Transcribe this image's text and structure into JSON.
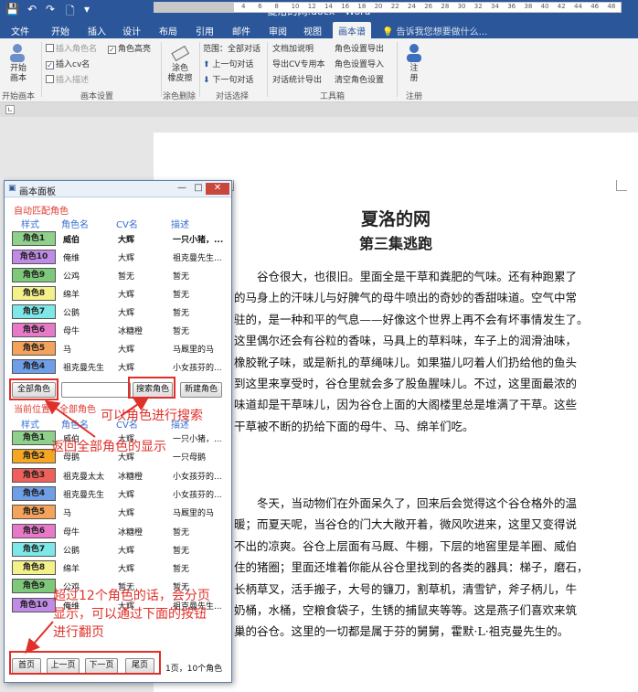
{
  "titlebar": {
    "title": "夏洛的网.docx - Word",
    "qa_save": "💾",
    "qa_undo": "↶",
    "qa_redo": "↷",
    "qa_new": "🗋",
    "qa_more": "▾"
  },
  "tabs": [
    "文件",
    "开始",
    "插入",
    "设计",
    "布局",
    "引用",
    "邮件",
    "审阅",
    "视图",
    "画本谱"
  ],
  "active_tab_index": 9,
  "tell_me": "告诉我您想要做什么...",
  "ribbon": {
    "g1": {
      "button": "开始\n画本",
      "label": "开始画本"
    },
    "g2": {
      "insert_role_name": "插入角色名",
      "insert_cv_name": "插入cv名",
      "insert_desc": "插入描述",
      "role_highlight": "角色高亮",
      "label": "画本设置"
    },
    "g3": {
      "button": "涂色\n橡皮擦",
      "label": "涂色删除"
    },
    "g4": {
      "range": "范围：全部对话",
      "prev": "上一句对话",
      "next": "下一句对话",
      "label": "对话选择"
    },
    "g5": {
      "c1": [
        "文档加说明",
        "导出CV专用本",
        "对话统计导出"
      ],
      "c2": [
        "角色设置导出",
        "角色设置导入",
        "清空角色设置"
      ],
      "label": "工具箱"
    },
    "g6": {
      "button": "注\n册",
      "label": "注册"
    }
  },
  "ruler_numbers": [
    "8",
    "6",
    "4",
    "2",
    "2",
    "4",
    "6",
    "8",
    "10",
    "12",
    "14",
    "16",
    "18",
    "20",
    "22",
    "24",
    "26",
    "28",
    "30",
    "32",
    "34",
    "36",
    "38",
    "40",
    "42",
    "44",
    "46",
    "48"
  ],
  "document": {
    "title": "夏洛的网",
    "subtitle": "第三集逃跑",
    "para1": [
      "谷仓很大，也很旧。里面全是干草和粪肥的气味。还有种跑累了",
      "的马身上的汗味儿与好脾气的母牛喷出的奇妙的香甜味道。空气中常",
      "驻的，是一种和平的气息——好像这个世界上再不会有坏事情发生了。",
      "这里偶尔还会有谷粒的香味，马具上的草料味，车子上的润滑油味，",
      "橡胶靴子味，或是新扎的草绳味儿。如果猫儿叼着人们扔给他的鱼头",
      "到这里来享受时，谷仓里就会多了股鱼腥味儿。不过，这里面最浓的",
      "味道却是干草味儿，因为谷仓上面的大阁楼里总是堆满了干草。这些",
      "干草被不断的扔给下面的母牛、马、绵羊们吃。"
    ],
    "para2": [
      "冬天，当动物们在外面呆久了，回来后会觉得这个谷仓格外的温",
      "暖；而夏天呢，当谷仓的门大大敞开着，微风吹进来，这里又变得说",
      "不出的凉爽。谷仓上层面有马厩、牛棚，下层的地窖里是羊圈、威伯",
      "住的猪圈；里面还堆着你能从谷仓里找到的各类的器具：梯子，磨石，",
      "长柄草叉，活手搬子，大号的镰刀，割草机，清雪铲，斧子柄儿，牛",
      "奶桶，水桶，空粮食袋子，生锈的捕鼠夹等等。这是燕子们喜欢来筑",
      "巢的谷仓。这里的一切都是属于芬的舅舅，霍默·L·祖克曼先生的。"
    ]
  },
  "panel": {
    "title": "画本面板",
    "btn_min": "—",
    "btn_max": "□",
    "btn_close": "✕",
    "auto_match_title": "自动匹配角色",
    "headers": {
      "style": "样式",
      "role": "角色名",
      "cv": "CV名",
      "desc": "描述"
    },
    "auto_rows": [
      {
        "chip": "角色1",
        "color": "#8fd18a",
        "role": "威伯",
        "cv": "大辉",
        "desc": "一只小猪，...",
        "bold": true
      },
      {
        "chip": "角色10",
        "color": "#c08ae6",
        "role": "俺维",
        "cv": "大辉",
        "desc": "祖克曼先生...",
        "bold": false
      },
      {
        "chip": "角色9",
        "color": "#7ec87a",
        "role": "公鸡",
        "cv": "暂无",
        "desc": "暂无",
        "bold": false
      },
      {
        "chip": "角色8",
        "color": "#f4f08a",
        "role": "绵羊",
        "cv": "大辉",
        "desc": "暂无",
        "bold": false
      },
      {
        "chip": "角色7",
        "color": "#7ee8e8",
        "role": "公鹅",
        "cv": "大辉",
        "desc": "暂无",
        "bold": false
      },
      {
        "chip": "角色6",
        "color": "#e879c9",
        "role": "母牛",
        "cv": "冰糖橙",
        "desc": "暂无",
        "bold": false
      },
      {
        "chip": "角色5",
        "color": "#f5a25a",
        "role": "马",
        "cv": "大辉",
        "desc": "马厩里的马",
        "bold": false
      },
      {
        "chip": "角色4",
        "color": "#6e9ee8",
        "role": "祖克曼先生",
        "cv": "大辉",
        "desc": "小女孩芬的...",
        "bold": false
      }
    ],
    "btn_all_roles": "全部角色",
    "btn_search": "搜索角色",
    "btn_new": "新建角色",
    "current_location": "当前位置：全部角色",
    "all_rows": [
      {
        "chip": "角色1",
        "color": "#8fd18a",
        "role": "威伯",
        "cv": "大辉",
        "desc": "一只小猪，..."
      },
      {
        "chip": "角色2",
        "color": "#f5a623",
        "role": "母鹅",
        "cv": "大辉",
        "desc": "一只母鹅"
      },
      {
        "chip": "角色3",
        "color": "#f0605a",
        "role": "祖克曼太太",
        "cv": "冰糖橙",
        "desc": "小女孩芬的..."
      },
      {
        "chip": "角色4",
        "color": "#6e9ee8",
        "role": "祖克曼先生",
        "cv": "大辉",
        "desc": "小女孩芬的..."
      },
      {
        "chip": "角色5",
        "color": "#f5a25a",
        "role": "马",
        "cv": "大辉",
        "desc": "马厩里的马"
      },
      {
        "chip": "角色6",
        "color": "#e879c9",
        "role": "母牛",
        "cv": "冰糖橙",
        "desc": "暂无"
      },
      {
        "chip": "角色7",
        "color": "#7ee8e8",
        "role": "公鹅",
        "cv": "大辉",
        "desc": "暂无"
      },
      {
        "chip": "角色8",
        "color": "#f4f08a",
        "role": "绵羊",
        "cv": "大辉",
        "desc": "暂无"
      },
      {
        "chip": "角色9",
        "color": "#7ec87a",
        "role": "公鸡",
        "cv": "暂无",
        "desc": "暂无"
      },
      {
        "chip": "角色10",
        "color": "#c08ae6",
        "role": "俺维",
        "cv": "大辉",
        "desc": "祖克曼先生..."
      }
    ],
    "pager": {
      "first": "首页",
      "prev": "上一页",
      "next": "下一页",
      "last": "尾页",
      "info": "1页，10个角色"
    }
  },
  "annotations": {
    "search": "可以角色进行搜索",
    "return_all": "返回全部角色的显示",
    "paging": [
      "超过12个角色的话，会分页",
      "显示，可以通过下面的按钮",
      "进行翻页"
    ]
  },
  "colors": {
    "word_blue": "#2b579a",
    "annotation_red": "#e0302a",
    "header_blue": "#3a6fd0"
  }
}
